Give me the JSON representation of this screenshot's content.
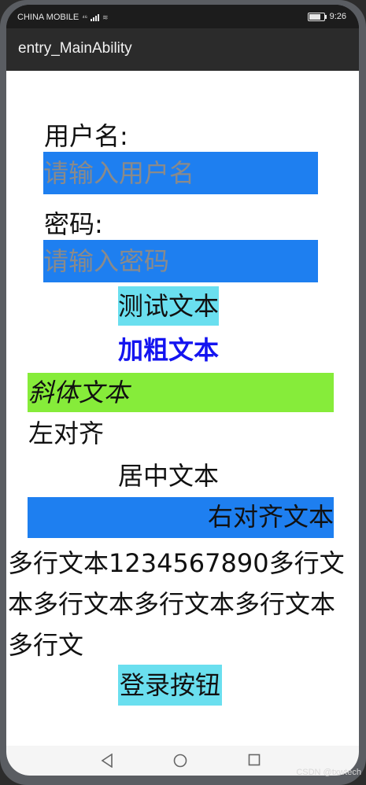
{
  "status_bar": {
    "carrier": "CHINA MOBILE",
    "network": "⁴⁶",
    "time": "9:26"
  },
  "title_bar": {
    "title": "entry_MainAbility"
  },
  "form": {
    "username_label": "用户名:",
    "username_placeholder": "请输入用户名",
    "password_label": "密码:",
    "password_placeholder": "请输入密码"
  },
  "texts": {
    "test_text": "测试文本",
    "bold_text": "加粗文本",
    "italic_text": "斜体文本",
    "left_text": "左对齐",
    "center_text": "居中文本",
    "right_text": "右对齐文本",
    "multiline_text": "多行文本1234567890多行文本多行文本多行文本多行文本多行文"
  },
  "button": {
    "login_label": "登录按钮"
  },
  "watermark": "CSDN @txwtech",
  "colors": {
    "input_bg": "#1e7ff0",
    "cyan_bg": "#6adfef",
    "green_bg": "#86ec3a",
    "bold_color": "#1414f0"
  }
}
